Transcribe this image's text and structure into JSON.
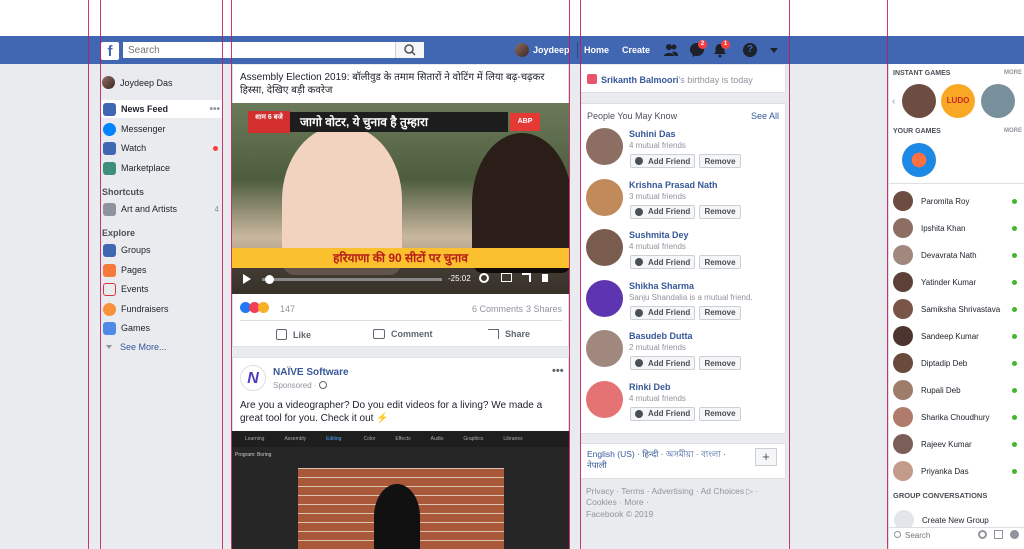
{
  "topbar": {
    "search_placeholder": "Search",
    "profile_name": "Joydeep",
    "home": "Home",
    "create": "Create",
    "messenger_count": "2",
    "notif_count": "1"
  },
  "sidebar": {
    "profile_name": "Joydeep Das",
    "items": [
      {
        "label": "News Feed",
        "icon": "news-feed-icon"
      },
      {
        "label": "Messenger",
        "icon": "messenger-icon"
      },
      {
        "label": "Watch",
        "icon": "watch-icon"
      },
      {
        "label": "Marketplace",
        "icon": "marketplace-icon"
      }
    ],
    "shortcuts_title": "Shortcuts",
    "shortcut": {
      "label": "Art and Artists",
      "count": "4"
    },
    "explore_title": "Explore",
    "explore": [
      {
        "label": "Groups"
      },
      {
        "label": "Pages"
      },
      {
        "label": "Events"
      },
      {
        "label": "Fundraisers"
      },
      {
        "label": "Games"
      }
    ],
    "see_more": "See More..."
  },
  "feed": {
    "post1": {
      "title": "Assembly Election 2019: बॉलीवुड के तमाम सितारों ने वोटिंग में लिया बढ़-चढ़कर हिस्सा, देखिए बड़ी कवरेज",
      "video_banner_top": "जागो वोटर, ये चुनाव है तुम्हारा",
      "video_banner_side": "शाम 6 बजे",
      "video_banner_bottom": "हरियाणा की 90 सीटों पर चुनाव",
      "video_time": "-25:02",
      "channel_logo": "ABP",
      "reactions_count": "147",
      "comments": "6 Comments",
      "shares": "3 Shares",
      "like": "Like",
      "comment": "Comment",
      "share": "Share"
    },
    "post2": {
      "page_name": "NAÏVE Software",
      "sponsored": "Sponsored ·",
      "logo_letter": "N",
      "text": "Are you a videographer? Do you edit videos for a living? We made a great tool for you. Check it out ⚡",
      "editor_tabs": [
        "Learning",
        "Assembly",
        "Editing",
        "Color",
        "Effects",
        "Audio",
        "Graphics",
        "Libraries"
      ],
      "program_label": "Program: Boring"
    }
  },
  "rightcol": {
    "birthday_name": "Srikanth Balmoori",
    "birthday_text": "'s birthday is today",
    "pymk_title": "People You May Know",
    "see_all": "See All",
    "add_friend": "Add Friend",
    "remove": "Remove",
    "people": [
      {
        "name": "Suhini Das",
        "mutual": "4 mutual friends"
      },
      {
        "name": "Krishna Prasad Nath",
        "mutual": "3 mutual friends"
      },
      {
        "name": "Sushmita Dey",
        "mutual": "4 mutual friends"
      },
      {
        "name": "Shikha Sharma",
        "mutual": "Sanju Shandalia is a mutual friend."
      },
      {
        "name": "Basudeb Dutta",
        "mutual": "2 mutual friends"
      },
      {
        "name": "Rinki Deb",
        "mutual": "4 mutual friends"
      }
    ],
    "languages": "English (US) · हिन्दी · অসমীয়া · বাংলা · नेपाली",
    "footer_links": "Privacy · Terms · Advertising · Ad Choices ▷ · Cookies · More ·",
    "copyright": "Facebook © 2019"
  },
  "chat": {
    "instant_games": "INSTANT GAMES",
    "your_games": "YOUR GAMES",
    "more": "MORE",
    "game_ludo": "LUDO",
    "contacts": [
      {
        "name": "Paromita Roy"
      },
      {
        "name": "Ipshita Khan"
      },
      {
        "name": "Devavrata Nath"
      },
      {
        "name": "Yatinder Kumar"
      },
      {
        "name": "Samiksha Shrivastava"
      },
      {
        "name": "Sandeep Kumar"
      },
      {
        "name": "Diptadip Deb"
      },
      {
        "name": "Rupali Deb"
      },
      {
        "name": "Sharika Choudhury"
      },
      {
        "name": "Rajeev Kumar"
      },
      {
        "name": "Priyanka Das"
      }
    ],
    "group_conversations": "GROUP CONVERSATIONS",
    "create_group": "Create New Group",
    "search_placeholder": "Search"
  },
  "colors": {
    "brand": "#4267b2",
    "link": "#365899",
    "online": "#42b72a",
    "notification": "#fa3e3e",
    "guide_lines": "#c2185b"
  }
}
